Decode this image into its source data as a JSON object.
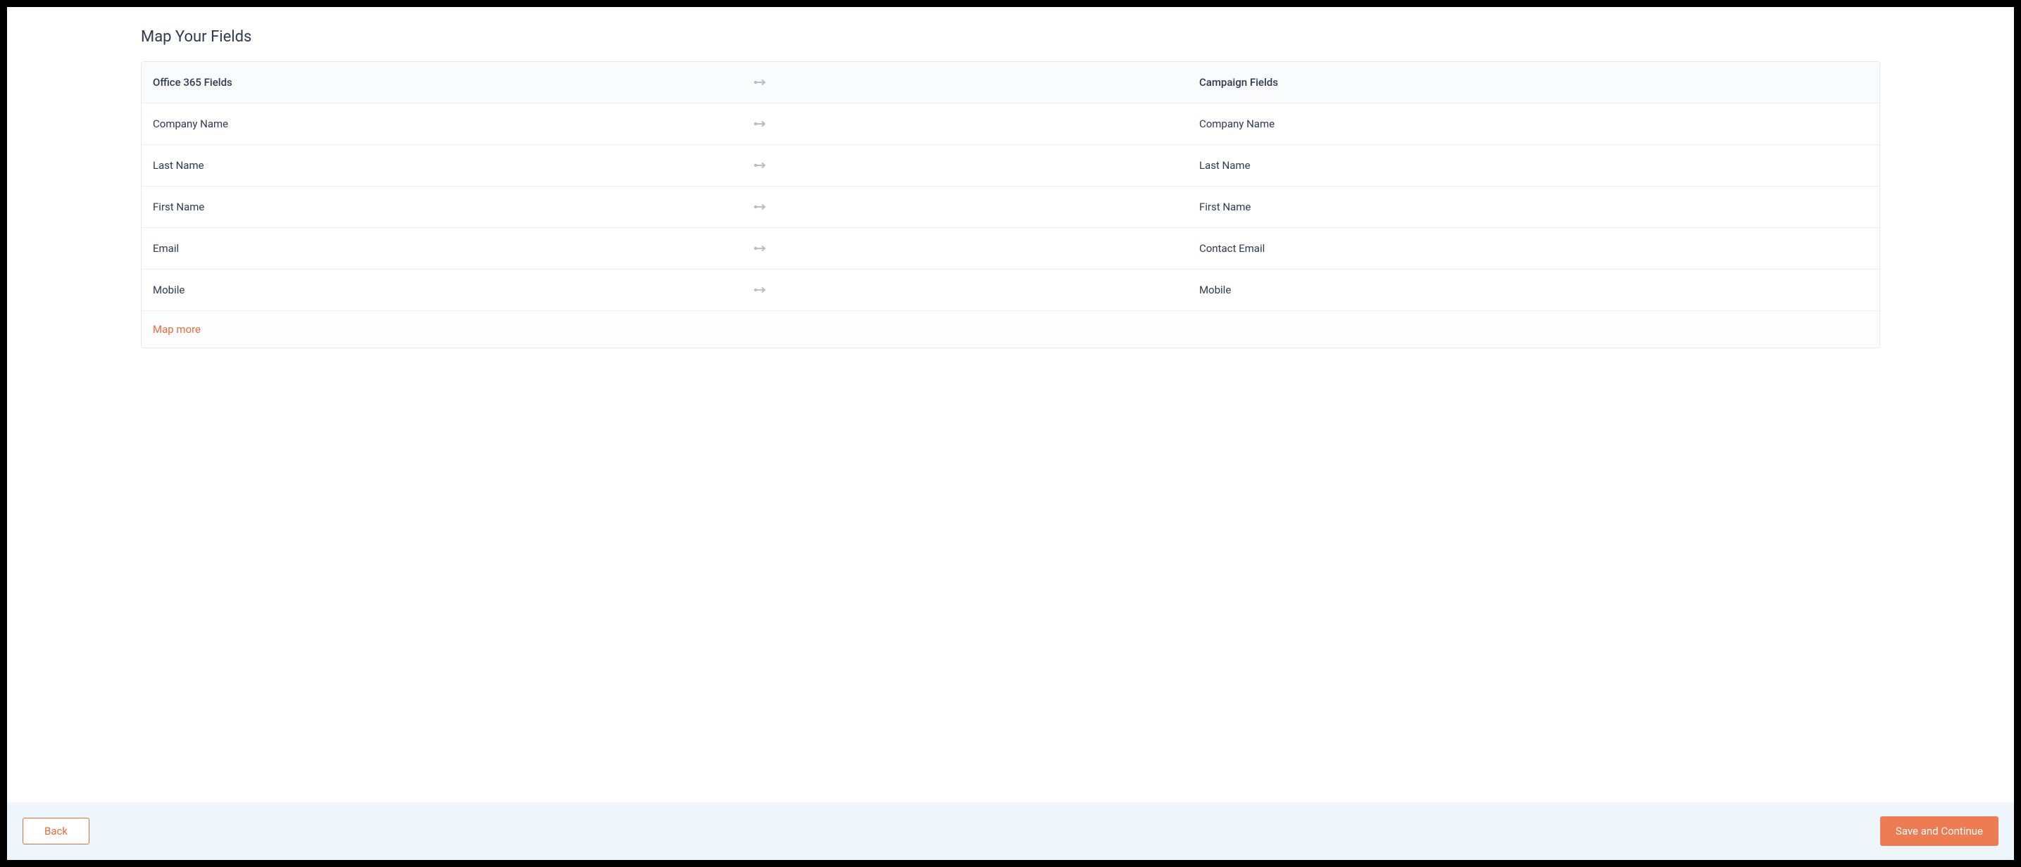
{
  "title": "Map Your Fields",
  "columns": {
    "source": "Office 365 Fields",
    "target": "Campaign Fields"
  },
  "rows": [
    {
      "source": "Company Name",
      "target": "Company Name"
    },
    {
      "source": "Last Name",
      "target": "Last Name"
    },
    {
      "source": "First Name",
      "target": "First Name"
    },
    {
      "source": "Email",
      "target": "Contact Email"
    },
    {
      "source": "Mobile",
      "target": "Mobile"
    }
  ],
  "links": {
    "map_more": "Map more"
  },
  "buttons": {
    "back": "Back",
    "save": "Save and Continue"
  }
}
